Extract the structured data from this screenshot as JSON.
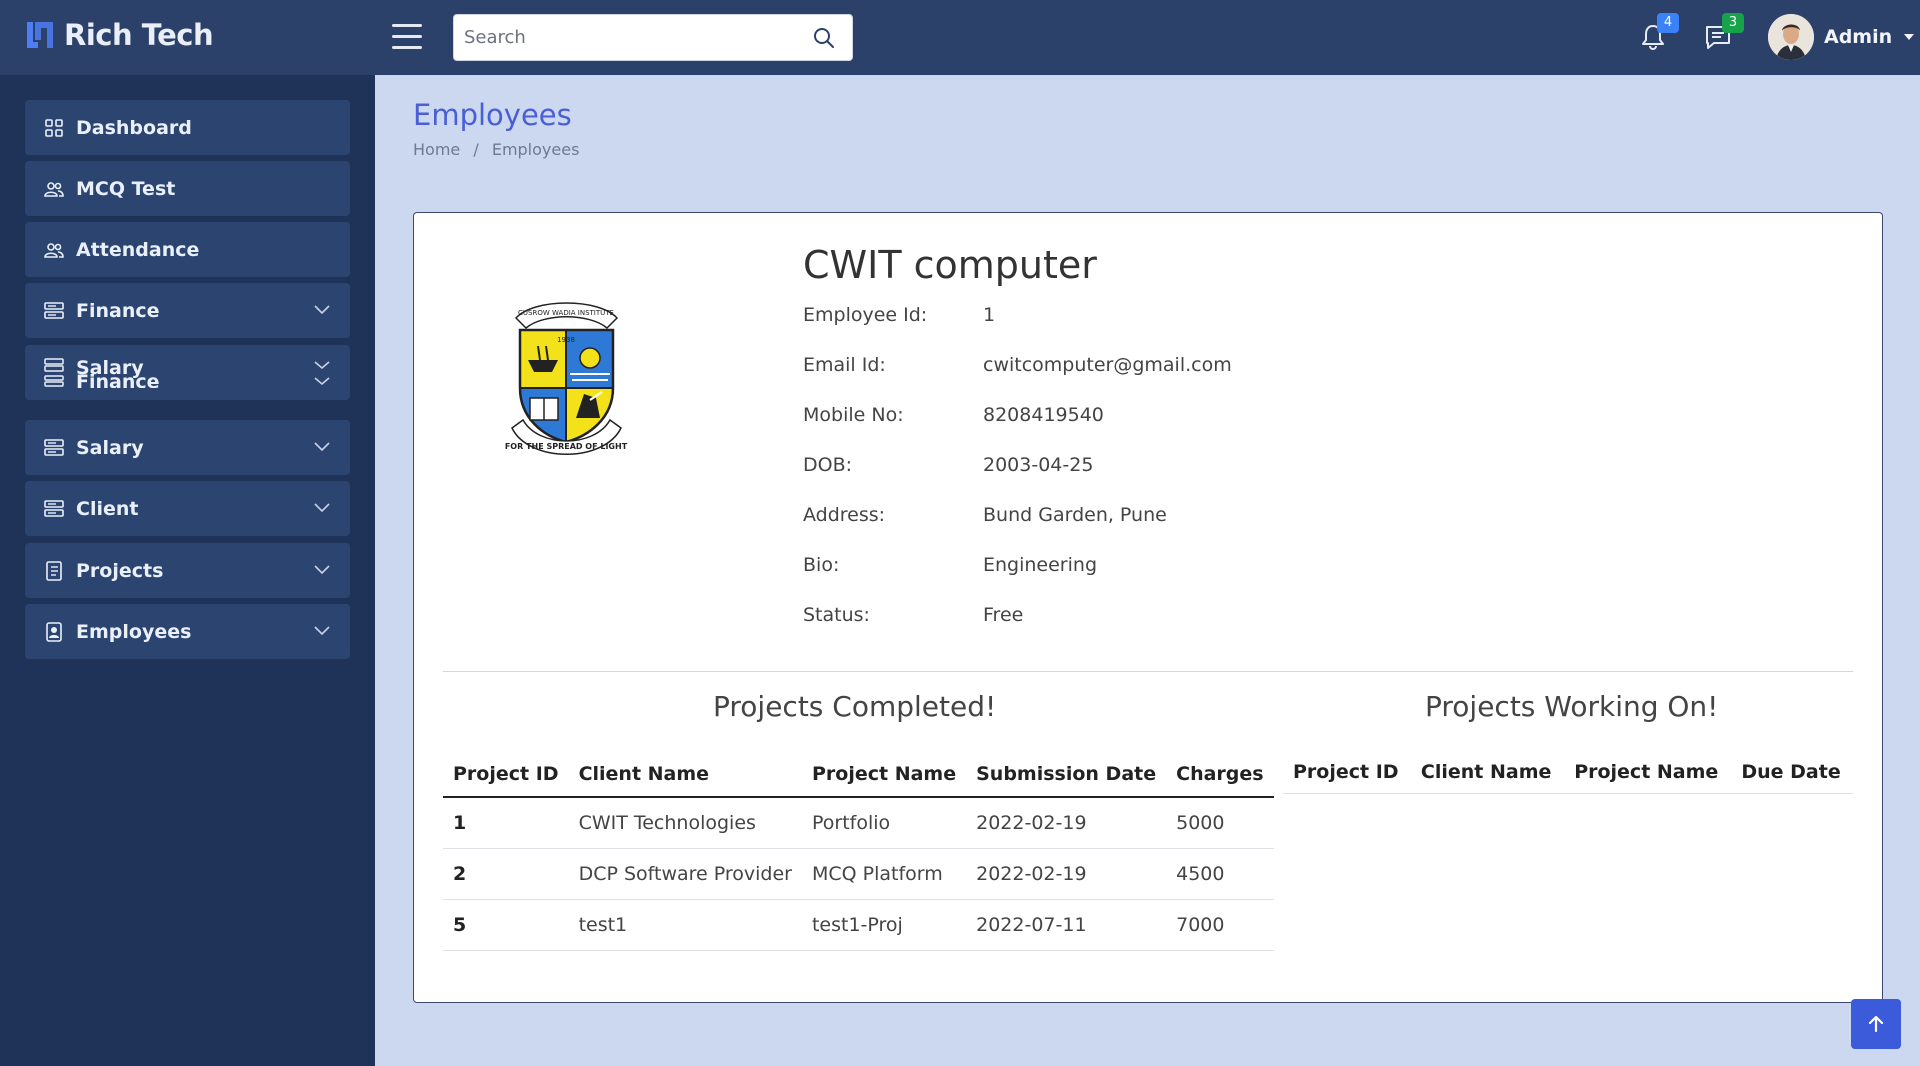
{
  "brand": {
    "name": "Rich Tech"
  },
  "header": {
    "search_placeholder": "Search",
    "notifications_count": "4",
    "messages_count": "3",
    "user_name": "Admin",
    "colors": {
      "header_bg": "#2b416a",
      "notif_badge": "#3b82f6",
      "msg_badge": "#16a34a"
    }
  },
  "sidebar": {
    "items": [
      {
        "label": "Dashboard",
        "icon": "grid-icon"
      },
      {
        "label": "MCQ Test",
        "icon": "people-icon"
      },
      {
        "label": "Attendance",
        "icon": "people-icon"
      },
      {
        "label": "Finance",
        "icon": "stack-icon"
      },
      {
        "label_top": "Salary",
        "label_bottom": "Finance",
        "icon": "stack-icon"
      },
      {
        "label": "Salary",
        "icon": "stack-icon"
      },
      {
        "label": "Client",
        "icon": "stack-icon"
      },
      {
        "label": "Projects",
        "icon": "journal-icon"
      },
      {
        "label": "Employees",
        "icon": "person-badge-icon"
      }
    ]
  },
  "page": {
    "title": "Employees",
    "breadcrumb": [
      "Home",
      "Employees"
    ]
  },
  "employee": {
    "name": "CWIT computer",
    "fields": [
      {
        "key": "Employee Id:",
        "value": "1"
      },
      {
        "key": "Email Id:",
        "value": "cwitcomputer@gmail.com"
      },
      {
        "key": "Mobile No:",
        "value": "8208419540"
      },
      {
        "key": "DOB:",
        "value": "2003-04-25"
      },
      {
        "key": "Address:",
        "value": "Bund Garden, Pune"
      },
      {
        "key": "Bio:",
        "value": "Engineering"
      },
      {
        "key": "Status:",
        "value": "Free"
      }
    ],
    "crest": {
      "top_text": "CUSROW WADIA INSTITUTE",
      "year": "1938",
      "motto": "FOR THE SPREAD OF LIGHT"
    }
  },
  "completed": {
    "title": "Projects Completed!",
    "columns": [
      "Project ID",
      "Client Name",
      "Project Name",
      "Submission Date",
      "Charges"
    ],
    "rows": [
      [
        "1",
        "CWIT Technologies",
        "Portfolio",
        "2022-02-19",
        "5000"
      ],
      [
        "2",
        "DCP Software Provider",
        "MCQ Platform",
        "2022-02-19",
        "4500"
      ],
      [
        "5",
        "test1",
        "test1-Proj",
        "2022-07-11",
        "7000"
      ]
    ]
  },
  "working": {
    "title": "Projects Working On!",
    "columns": [
      "Project ID",
      "Client Name",
      "Project Name",
      "Due Date"
    ],
    "rows": []
  }
}
